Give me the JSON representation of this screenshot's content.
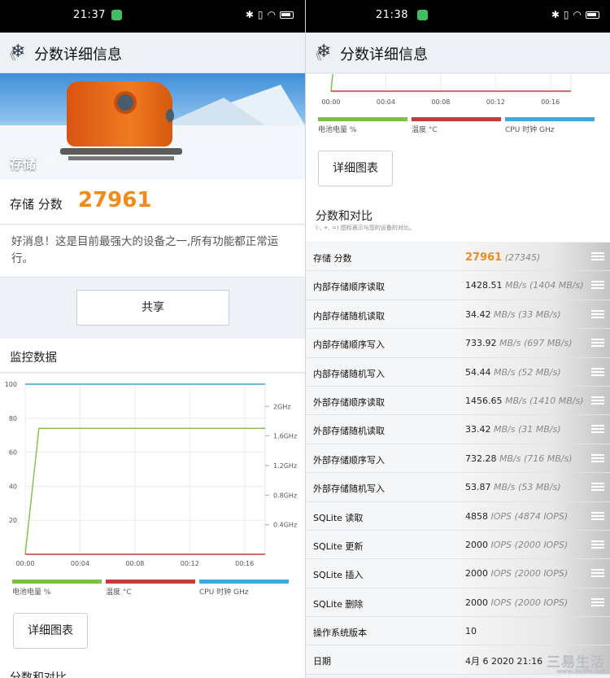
{
  "left": {
    "status": {
      "time": "21:37"
    },
    "appbar": {
      "back": "《",
      "title": "分数详细信息"
    },
    "hero": {
      "label": "存储",
      "version": "1.0"
    },
    "score": {
      "label": "存储 分数",
      "value": "27961"
    },
    "message": "好消息！这是目前最强大的设备之一,所有功能都正常运行。",
    "share_label": "共享",
    "monitor_title": "监控数据",
    "detail_label": "详细图表",
    "compare_title_peek": "分数和对比"
  },
  "right": {
    "status": {
      "time": "21:38"
    },
    "appbar": {
      "back": "《",
      "title": "分数详细信息"
    },
    "detail_label": "详细图表",
    "compare_title": "分数和对比",
    "compare_subtitle": "(-, +, =) 图标表示与您的设备的对比。",
    "rows": [
      {
        "label": "存储 分数",
        "value": "27961",
        "unit": "",
        "ref": "(27345)"
      },
      {
        "label": "内部存储顺序读取",
        "value": "1428.51",
        "unit": "MB/s",
        "ref": "(1404 MB/s)"
      },
      {
        "label": "内部存储随机读取",
        "value": "34.42",
        "unit": "MB/s",
        "ref": "(33 MB/s)"
      },
      {
        "label": "内部存储顺序写入",
        "value": "733.92",
        "unit": "MB/s",
        "ref": "(697 MB/s)"
      },
      {
        "label": "内部存储随机写入",
        "value": "54.44",
        "unit": "MB/s",
        "ref": "(52 MB/s)"
      },
      {
        "label": "外部存储顺序读取",
        "value": "1456.65",
        "unit": "MB/s",
        "ref": "(1410 MB/s)"
      },
      {
        "label": "外部存储随机读取",
        "value": "33.42",
        "unit": "MB/s",
        "ref": "(31 MB/s)"
      },
      {
        "label": "外部存储顺序写入",
        "value": "732.28",
        "unit": "MB/s",
        "ref": "(716 MB/s)"
      },
      {
        "label": "外部存储随机写入",
        "value": "53.87",
        "unit": "MB/s",
        "ref": "(53 MB/s)"
      },
      {
        "label": "SQLite 读取",
        "value": "4858",
        "unit": "IOPS",
        "ref": "(4874 IOPS)"
      },
      {
        "label": "SQLite 更新",
        "value": "2000",
        "unit": "IOPS",
        "ref": "(2000 IOPS)"
      },
      {
        "label": "SQLite 插入",
        "value": "2000",
        "unit": "IOPS",
        "ref": "(2000 IOPS)"
      },
      {
        "label": "SQLite 删除",
        "value": "2000",
        "unit": "IOPS",
        "ref": "(2000 IOPS)"
      },
      {
        "label": "操作系统版本",
        "value": "10",
        "unit": "",
        "ref": ""
      },
      {
        "label": "日期",
        "value": "4月 6 2020 21:16",
        "unit": "",
        "ref": ""
      }
    ]
  },
  "watermark": {
    "text": "三易生活",
    "sub": "www.3elife.net"
  },
  "colors": {
    "battery": "#7bc142",
    "temperature": "#c93a3a",
    "cpu": "#3aa9e0",
    "accent": "#f08a1a"
  },
  "chart_data": {
    "type": "line",
    "x": [
      "00:00",
      "00:04",
      "00:08",
      "00:12",
      "00:16"
    ],
    "xlim": [
      0,
      17.5
    ],
    "yticks_left": [
      "100",
      "80",
      "60",
      "40",
      "20"
    ],
    "ylim_left": [
      0,
      100
    ],
    "yticks_right": [
      "2GHz",
      "1.6GHz",
      "1.2GHz",
      "0.8GHz",
      "0.4GHz"
    ],
    "ylim_right": [
      0,
      2.3
    ],
    "series": [
      {
        "name": "电池电量 %",
        "color": "#7bc142",
        "points": [
          [
            0,
            0
          ],
          [
            1,
            74
          ],
          [
            17.5,
            74
          ]
        ]
      },
      {
        "name": "温度 °C",
        "color": "#c93a3a",
        "points": [
          [
            0,
            0
          ],
          [
            17.5,
            0
          ]
        ]
      },
      {
        "name": "CPU 时钟 GHz",
        "color": "#3aa9e0",
        "points": [
          [
            0,
            100
          ],
          [
            17.5,
            100
          ]
        ]
      }
    ],
    "legend": [
      "电池电量 %",
      "温度 °C",
      "CPU 时钟 GHz"
    ]
  }
}
